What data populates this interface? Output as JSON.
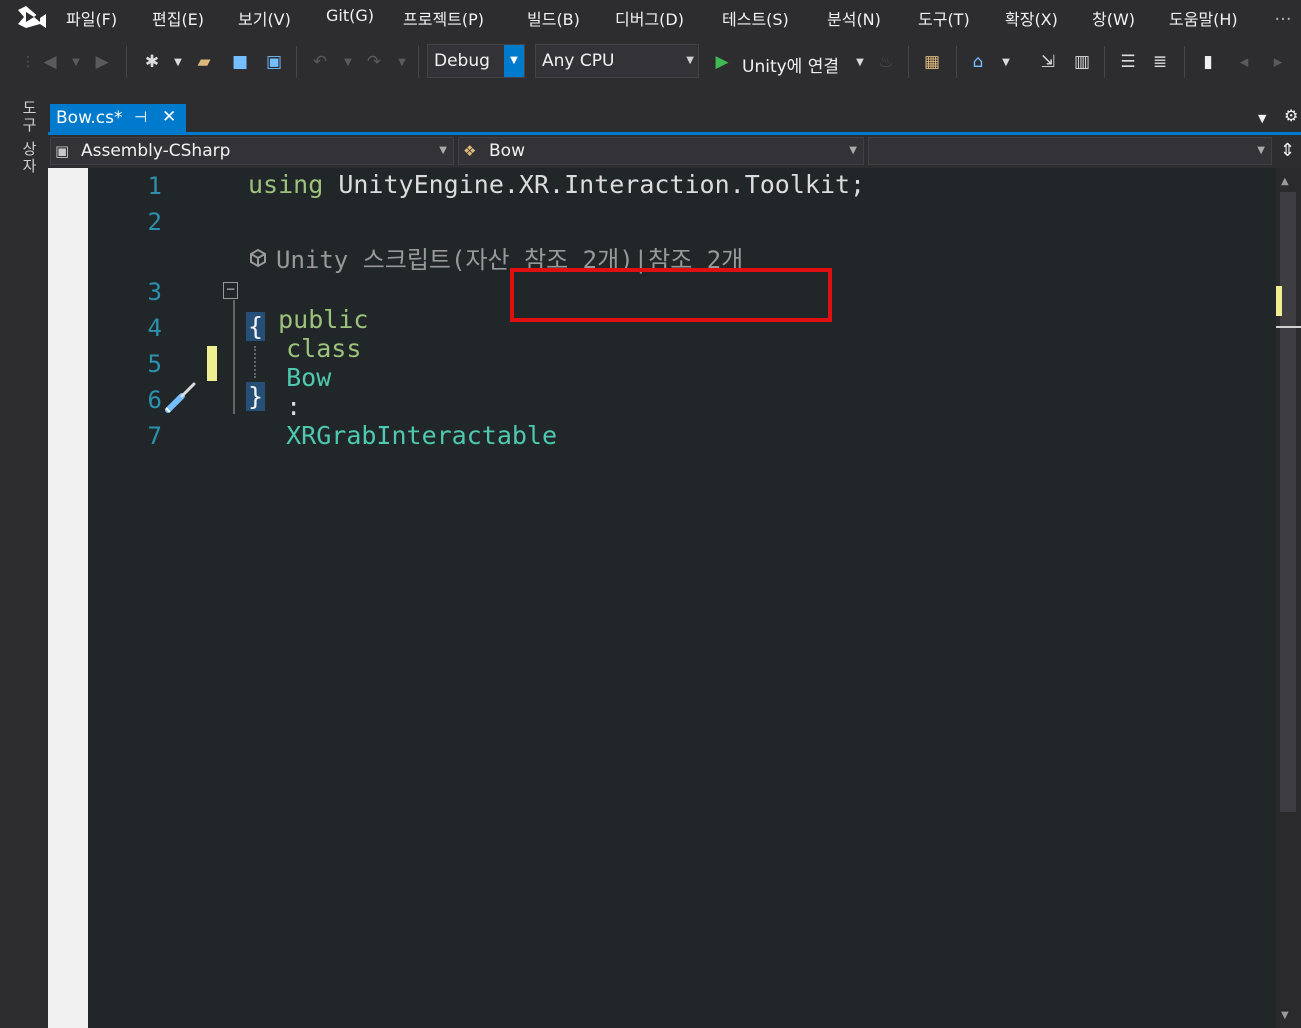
{
  "menu": {
    "items": [
      "파일(F)",
      "편집(E)",
      "보기(V)",
      "Git(G)",
      "프로젝트(P)",
      "빌드(B)",
      "디버그(D)",
      "테스트(S)",
      "분석(N)",
      "도구(T)",
      "확장(X)",
      "창(W)",
      "도움말(H)"
    ],
    "overflow": "..."
  },
  "toolbar": {
    "config": "Debug",
    "platform": "Any CPU",
    "run_label": "Unity에 연결"
  },
  "side_tab": {
    "label": "도구 상자"
  },
  "doc_tab": {
    "label": "Bow.cs*",
    "pin": "⊣",
    "close": "✕"
  },
  "navbar": {
    "project": "Assembly-CSharp",
    "type": "Bow",
    "member": ""
  },
  "editor": {
    "line_numbers": [
      "1",
      "2",
      "3",
      "4",
      "5",
      "6",
      "7"
    ],
    "line1": {
      "keyword": "using",
      "rest": " UnityEngine.XR.Interaction.Toolkit;"
    },
    "codelens": "Unity 스크립트(자산 참조 2개)|참조 2개",
    "line3": {
      "kw1": "public",
      "kw2": "class",
      "name": "Bow",
      "colon": ":",
      "base": "XRGrabInteractable"
    },
    "open_brace": "{",
    "close_brace": "}"
  },
  "colors": {
    "accent": "#007acc",
    "highlight_box": "#e01010",
    "change_marker": "#efef91",
    "type": "#4ec9b0",
    "line_number": "#2b91af"
  }
}
